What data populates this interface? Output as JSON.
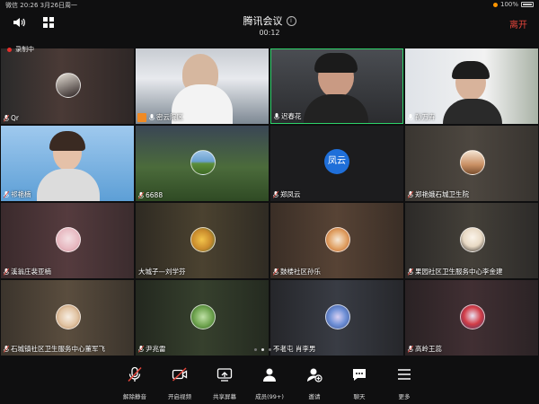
{
  "status_bar": {
    "carrier": "微信",
    "time": "20:26",
    "date": "3月26日周一",
    "battery": "100%"
  },
  "header": {
    "title": "腾讯会议",
    "timer": "00:12",
    "leave_label": "离开"
  },
  "recording_label": "录制中",
  "participants": [
    {
      "name": "Qr"
    },
    {
      "name": "密云院区"
    },
    {
      "name": "迟春花"
    },
    {
      "name": "孙万卉"
    },
    {
      "name": "祁艳楠"
    },
    {
      "name": "6688"
    },
    {
      "name": "郑凤云",
      "initials": "凤云"
    },
    {
      "name": "郑艳娥石城卫生院"
    },
    {
      "name": "溪翁庄裴亚楠"
    },
    {
      "name": "大城子—刘学芬"
    },
    {
      "name": "鼓楼社区孙乐"
    },
    {
      "name": "果园社区卫生服务中心李金建"
    },
    {
      "name": "石城镇社区卫生服务中心董军飞"
    },
    {
      "name": "尹兆雷"
    },
    {
      "name": "不老屯 肖李男"
    },
    {
      "name": "高岭王蕊"
    }
  ],
  "pager": {
    "pages": 5,
    "current": 2
  },
  "toolbar": [
    {
      "label": "解除静音",
      "icon": "mic-muted-icon"
    },
    {
      "label": "开启视频",
      "icon": "video-off-icon"
    },
    {
      "label": "共享屏幕",
      "icon": "share-screen-icon"
    },
    {
      "label": "成员(99+)",
      "icon": "members-icon"
    },
    {
      "label": "邀请",
      "icon": "invite-icon"
    },
    {
      "label": "聊天",
      "icon": "chat-icon"
    },
    {
      "label": "更多",
      "icon": "more-icon"
    }
  ],
  "colors": {
    "accent_red": "#e5453b",
    "active_border": "#2ed36b",
    "avatar_blue": "#1f6fd9",
    "record_dot": "#e5302c"
  }
}
